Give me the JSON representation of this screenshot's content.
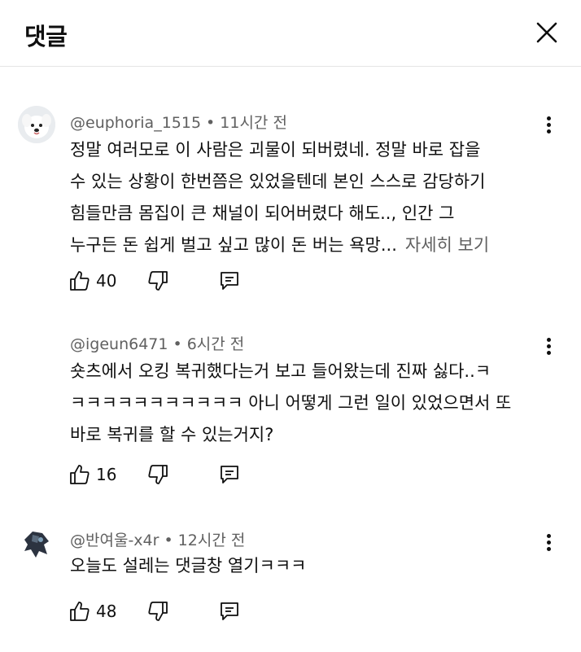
{
  "header": {
    "title": "댓글"
  },
  "comments": [
    {
      "author": "@euphoria_1515",
      "time": "11시간 전",
      "lines": [
        "정말 여러모로 이 사람은 괴물이 되버렸네. 정말 바로 잡을",
        "수 있는 상황이 한번쯤은 있었을텐데 본인 스스로 감당하기",
        "힘들만큼 몸집이 큰 채널이 되어버렸다 해도.., 인간 그",
        "누구든 돈 쉽게 벌고 싶고 많이 돈 버는 욕망..."
      ],
      "more": "자세히 보기",
      "likes": "40"
    },
    {
      "author": "@igeun6471",
      "time": "6시간 전",
      "lines": [
        "숏츠에서 오킹 복귀했다는거 보고 들어왔는데 진짜 싫다..ㅋ",
        "ㅋㅋㅋㅋㅋㅋㅋㅋㅋㅋㅋ 아니 어떻게 그런 일이 있었으면서 또",
        "바로 복귀를 할 수 있는거지?"
      ],
      "likes": "16"
    },
    {
      "author": "@반여울-x4r",
      "time": "12시간 전",
      "lines": [
        "오늘도 설레는 댓글창 열기ㅋㅋㅋ"
      ],
      "likes": "48"
    }
  ],
  "icons": {
    "close": "close-icon",
    "like": "thumbs-up-icon",
    "dislike": "thumbs-down-icon",
    "reply": "reply-icon",
    "more": "more-vert-icon"
  },
  "colors": {
    "text": "#0f0f0f",
    "secondary": "#606060",
    "divider": "#e5e5e5"
  }
}
